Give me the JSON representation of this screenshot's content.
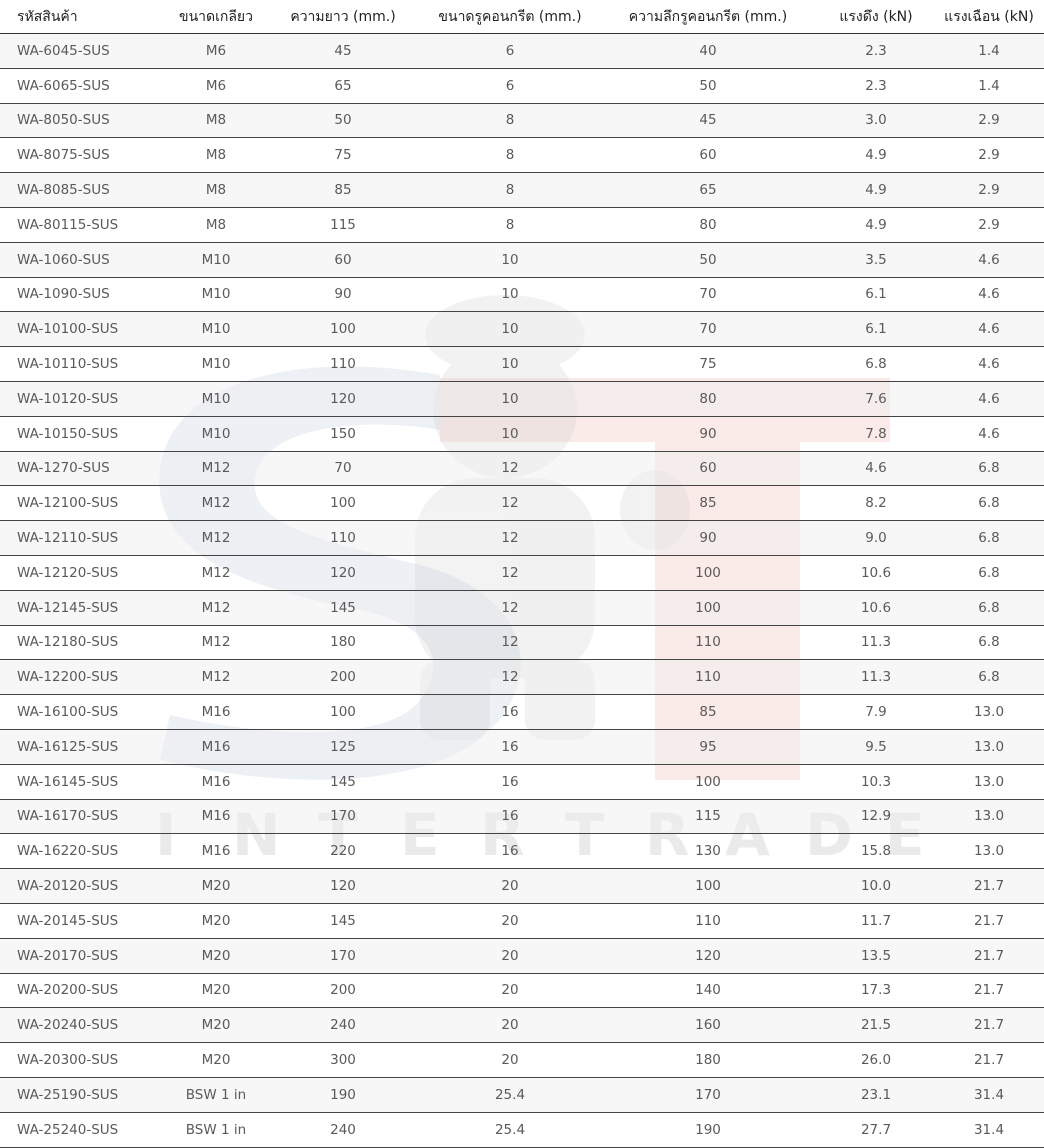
{
  "table": {
    "headers": [
      "รหัสสินค้า",
      "ขนาดเกลียว",
      "ความยาว (mm.)",
      "ขนาดรูคอนกรีต (mm.)",
      "ความลึกรูคอนกรีต (mm.)",
      "แรงดึง (kN)",
      "แรงเฉือน (kN)"
    ],
    "rows": [
      [
        "WA-6045-SUS",
        "M6",
        "45",
        "6",
        "40",
        "2.3",
        "1.4"
      ],
      [
        "WA-6065-SUS",
        "M6",
        "65",
        "6",
        "50",
        "2.3",
        "1.4"
      ],
      [
        "WA-8050-SUS",
        "M8",
        "50",
        "8",
        "45",
        "3.0",
        "2.9"
      ],
      [
        "WA-8075-SUS",
        "M8",
        "75",
        "8",
        "60",
        "4.9",
        "2.9"
      ],
      [
        "WA-8085-SUS",
        "M8",
        "85",
        "8",
        "65",
        "4.9",
        "2.9"
      ],
      [
        "WA-80115-SUS",
        "M8",
        "115",
        "8",
        "80",
        "4.9",
        "2.9"
      ],
      [
        "WA-1060-SUS",
        "M10",
        "60",
        "10",
        "50",
        "3.5",
        "4.6"
      ],
      [
        "WA-1090-SUS",
        "M10",
        "90",
        "10",
        "70",
        "6.1",
        "4.6"
      ],
      [
        "WA-10100-SUS",
        "M10",
        "100",
        "10",
        "70",
        "6.1",
        "4.6"
      ],
      [
        "WA-10110-SUS",
        "M10",
        "110",
        "10",
        "75",
        "6.8",
        "4.6"
      ],
      [
        "WA-10120-SUS",
        "M10",
        "120",
        "10",
        "80",
        "7.6",
        "4.6"
      ],
      [
        "WA-10150-SUS",
        "M10",
        "150",
        "10",
        "90",
        "7.8",
        "4.6"
      ],
      [
        "WA-1270-SUS",
        "M12",
        "70",
        "12",
        "60",
        "4.6",
        "6.8"
      ],
      [
        "WA-12100-SUS",
        "M12",
        "100",
        "12",
        "85",
        "8.2",
        "6.8"
      ],
      [
        "WA-12110-SUS",
        "M12",
        "110",
        "12",
        "90",
        "9.0",
        "6.8"
      ],
      [
        "WA-12120-SUS",
        "M12",
        "120",
        "12",
        "100",
        "10.6",
        "6.8"
      ],
      [
        "WA-12145-SUS",
        "M12",
        "145",
        "12",
        "100",
        "10.6",
        "6.8"
      ],
      [
        "WA-12180-SUS",
        "M12",
        "180",
        "12",
        "110",
        "11.3",
        "6.8"
      ],
      [
        "WA-12200-SUS",
        "M12",
        "200",
        "12",
        "110",
        "11.3",
        "6.8"
      ],
      [
        "WA-16100-SUS",
        "M16",
        "100",
        "16",
        "85",
        "7.9",
        "13.0"
      ],
      [
        "WA-16125-SUS",
        "M16",
        "125",
        "16",
        "95",
        "9.5",
        "13.0"
      ],
      [
        "WA-16145-SUS",
        "M16",
        "145",
        "16",
        "100",
        "10.3",
        "13.0"
      ],
      [
        "WA-16170-SUS",
        "M16",
        "170",
        "16",
        "115",
        "12.9",
        "13.0"
      ],
      [
        "WA-16220-SUS",
        "M16",
        "220",
        "16",
        "130",
        "15.8",
        "13.0"
      ],
      [
        "WA-20120-SUS",
        "M20",
        "120",
        "20",
        "100",
        "10.0",
        "21.7"
      ],
      [
        "WA-20145-SUS",
        "M20",
        "145",
        "20",
        "110",
        "11.7",
        "21.7"
      ],
      [
        "WA-20170-SUS",
        "M20",
        "170",
        "20",
        "120",
        "13.5",
        "21.7"
      ],
      [
        "WA-20200-SUS",
        "M20",
        "200",
        "20",
        "140",
        "17.3",
        "21.7"
      ],
      [
        "WA-20240-SUS",
        "M20",
        "240",
        "20",
        "160",
        "21.5",
        "21.7"
      ],
      [
        "WA-20300-SUS",
        "M20",
        "300",
        "20",
        "180",
        "26.0",
        "21.7"
      ],
      [
        "WA-25190-SUS",
        "BSW 1 in",
        "190",
        "25.4",
        "170",
        "23.1",
        "31.4"
      ],
      [
        "WA-25240-SUS",
        "BSW 1 in",
        "240",
        "25.4",
        "190",
        "27.7",
        "31.4"
      ]
    ]
  },
  "watermark": {
    "text": "INTERTRADE",
    "colors": {
      "s_letter": "#b8c6da",
      "t_letter": "#f0c7c1",
      "text": "#d6d6d6",
      "mascot": "#d9d9d9"
    }
  }
}
